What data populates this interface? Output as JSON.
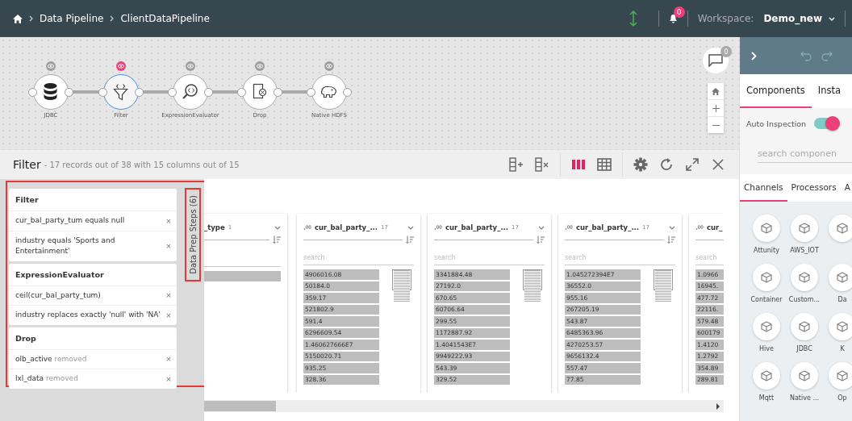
{
  "topbar": {
    "breadcrumbs": [
      "Data Pipeline",
      "ClientDataPipeline"
    ],
    "notifications": "0",
    "workspace_label": "Workspace:",
    "workspace": "Demo_new"
  },
  "canvas": {
    "nodes": [
      {
        "label": "JDBC",
        "selected": false
      },
      {
        "label": "Filter",
        "selected": true
      },
      {
        "label": "ExpressionEvaluator",
        "selected": false
      },
      {
        "label": "Drop",
        "selected": false
      },
      {
        "label": "Native HDFS",
        "selected": false
      }
    ],
    "comments": "0"
  },
  "preview": {
    "title": "Filter",
    "summary": "- 17 records out of 38 with 15 columns out of 15",
    "views": [
      {
        "kind": "columns",
        "selected": true
      },
      {
        "kind": "grid",
        "selected": false
      }
    ]
  },
  "steps": {
    "tab": "Data Prep Steps (6)",
    "groups": [
      {
        "title": "Filter",
        "steps": [
          {
            "text": "cur_bal_party_tum equals null",
            "remove": "×"
          },
          {
            "text": "industry equals 'Sports and Entertainment'",
            "remove": "×"
          }
        ]
      },
      {
        "title": "ExpressionEvaluator",
        "steps": [
          {
            "text": "ceil(cur_bal_party_tum)",
            "remove": "×"
          },
          {
            "text": "industry replaces exactly 'null' with 'NA'",
            "remove": "×"
          }
        ]
      },
      {
        "title": "Drop",
        "steps": [
          {
            "text": "olb_active",
            "note": "removed",
            "remove": "×"
          },
          {
            "text": "lxl_data",
            "note": "removed",
            "remove": "×"
          }
        ]
      }
    ]
  },
  "columns": [
    {
      "kind": "partial",
      "name": "_type",
      "count": "1"
    },
    {
      "kind": "full",
      "name": "cur_bal_party_...",
      "count": "17",
      "placeholder": "search",
      "values": [
        "4906016.08",
        "50184.0",
        "359.17",
        "521802.9",
        "591.4",
        "6296609.54",
        "1.460627666E7",
        "5150020.71",
        "935.25",
        "328.36"
      ]
    },
    {
      "kind": "full",
      "name": "cur_bal_party_...",
      "count": "17",
      "placeholder": "search",
      "values": [
        "3341884.48",
        "27192.0",
        "670.65",
        "60706.64",
        "299.55",
        "1172887.92",
        "1.4041543E7",
        "9949222.93",
        "543.39",
        "329.52"
      ]
    },
    {
      "kind": "full",
      "name": "cur_bal_party_...",
      "count": "17",
      "placeholder": "search",
      "values": [
        "1.045272394E7",
        "36552.0",
        "955.16",
        "267205.19",
        "543.87",
        "6485363.96",
        "4270253.57",
        "9656132.4",
        "557.47",
        "77.85"
      ]
    },
    {
      "kind": "cut",
      "name": "cur_",
      "placeholder": "search",
      "values": [
        "1.0966",
        "16945.",
        "477.72",
        "22116.",
        "579.48",
        "600179",
        "1.4120",
        "1.2792",
        "354.89",
        "289.81"
      ]
    }
  ],
  "panel": {
    "tabs": [
      {
        "label": "Components",
        "selected": true
      },
      {
        "label": "Insta",
        "selected": false
      }
    ],
    "auto_inspection": {
      "label": "Auto Inspection",
      "on": true
    },
    "search": {
      "placeholder": "search componen"
    },
    "categories": [
      {
        "label": "Channels",
        "selected": true
      },
      {
        "label": "Processors",
        "selected": false
      },
      {
        "label": "A",
        "selected": false
      }
    ],
    "components": [
      {
        "kind": "tile",
        "label": "Attunity"
      },
      {
        "kind": "tile",
        "label": "AWS_IOT"
      },
      {
        "kind": "icon_only"
      },
      {
        "kind": "tile",
        "label": "Container"
      },
      {
        "kind": "tile",
        "label": "Custom..."
      },
      {
        "kind": "tile",
        "label": "Da"
      },
      {
        "kind": "tile",
        "label": "Hive"
      },
      {
        "kind": "tile",
        "label": "JDBC"
      },
      {
        "kind": "tile",
        "label": "K"
      },
      {
        "kind": "tile",
        "label": "Mqtt"
      },
      {
        "kind": "tile",
        "label": "Native ..."
      },
      {
        "kind": "tile",
        "label": "Op"
      }
    ]
  }
}
